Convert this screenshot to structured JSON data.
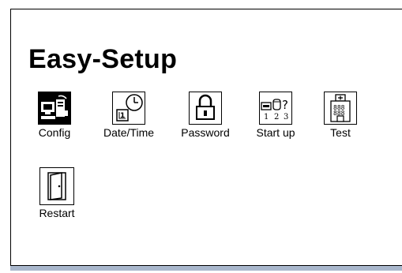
{
  "app": {
    "title": "Easy-Setup"
  },
  "tiles": [
    {
      "label": "Config",
      "icon": "computer-config-icon",
      "selected": true
    },
    {
      "label": "Date/Time",
      "icon": "clock-calendar-icon",
      "selected": false
    },
    {
      "label": "Password",
      "icon": "padlock-icon",
      "selected": false
    },
    {
      "label": "Start up",
      "icon": "startup-sequence-icon",
      "selected": false
    },
    {
      "label": "Test",
      "icon": "building-test-icon",
      "selected": false
    },
    {
      "label": "Restart",
      "icon": "door-restart-icon",
      "selected": false
    }
  ],
  "colors": {
    "selected_tile_bg": "#000000",
    "bottom_bar": "#a9b7cc"
  }
}
